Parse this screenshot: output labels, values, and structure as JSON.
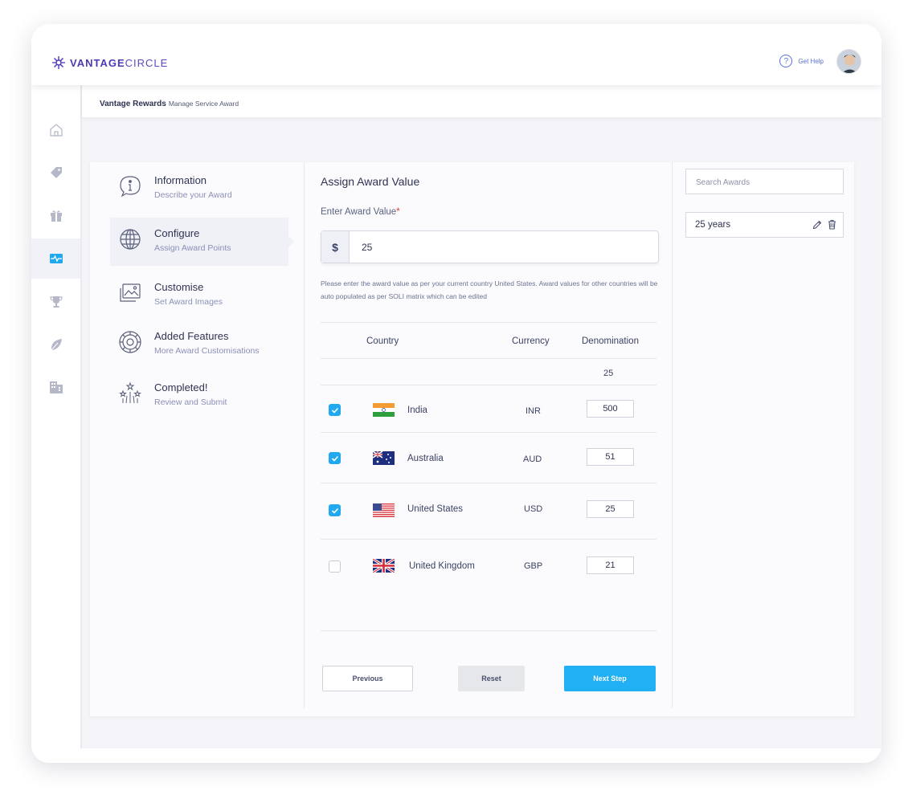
{
  "brand": {
    "bold": "VANTAGE",
    "light": "CIRCLE"
  },
  "header": {
    "help_label": "Get Help"
  },
  "breadcrumb": {
    "section": "Vantage Rewards",
    "page": "Manage Service Award"
  },
  "steps": [
    {
      "title": "Information",
      "subtitle": "Describe your Award"
    },
    {
      "title": "Configure",
      "subtitle": "Assign Award Points"
    },
    {
      "title": "Customise",
      "subtitle": "Set Award Images"
    },
    {
      "title": "Added Features",
      "subtitle": "More Award Customisations"
    },
    {
      "title": "Completed!",
      "subtitle": "Review and Submit"
    }
  ],
  "form": {
    "heading": "Assign Award Value",
    "label": "Enter Award Value",
    "required_mark": "*",
    "currency_symbol": "$",
    "value": "25",
    "hint": "Please enter the award value as per  your current country United States. Award values for other countries will be auto populated as per SOLI matrix which can be edited"
  },
  "table": {
    "headers": {
      "country": "Country",
      "currency": "Currency",
      "denomination": "Denomination"
    },
    "base_denomination": "25",
    "rows": [
      {
        "country": "India",
        "currency": "INR",
        "value": "500",
        "checked": true
      },
      {
        "country": "Australia",
        "currency": "AUD",
        "value": "51",
        "checked": true
      },
      {
        "country": "United States",
        "currency": "USD",
        "value": "25",
        "checked": true
      },
      {
        "country": "United Kingdom",
        "currency": "GBP",
        "value": "21",
        "checked": false
      }
    ]
  },
  "buttons": {
    "previous": "Previous",
    "reset": "Reset",
    "next": "Next Step"
  },
  "awards_panel": {
    "search_placeholder": "Search Awards",
    "items": [
      {
        "label": "25 years"
      }
    ]
  },
  "colors": {
    "accent": "#22b0f4",
    "brand": "#4b3bb3",
    "checkbox": "#20a9ef"
  }
}
